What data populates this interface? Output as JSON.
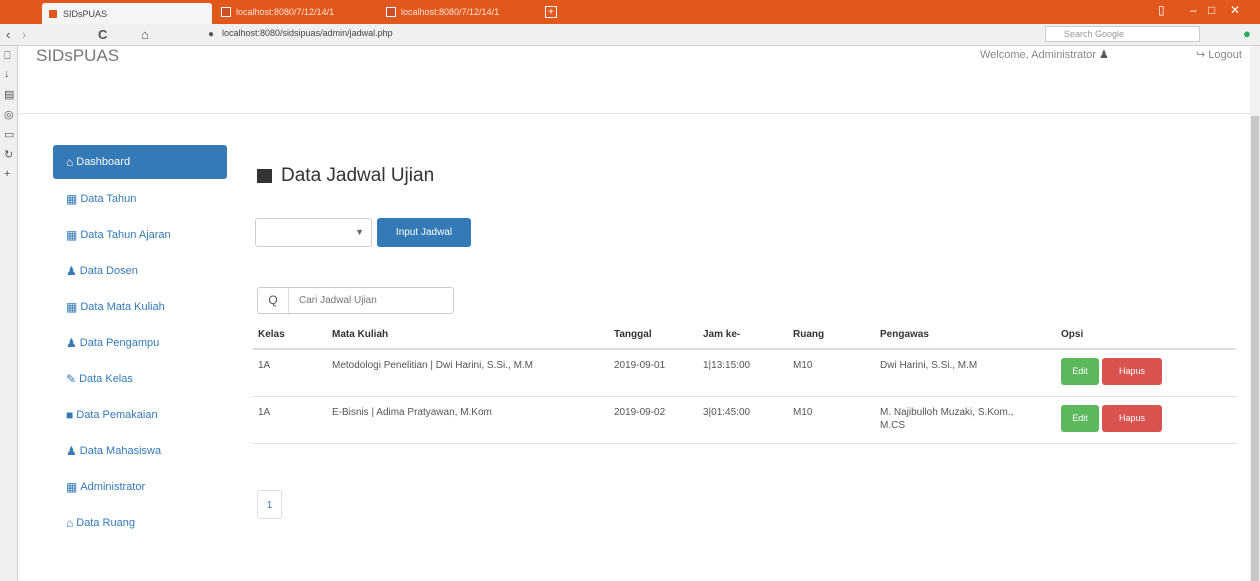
{
  "browser": {
    "tabs": [
      {
        "title": "SIDsPUAS"
      },
      {
        "title": "localhost:8080/7/12/14/1"
      },
      {
        "title": "localhost:8080/7/12/14/1"
      }
    ],
    "new_tab": "+",
    "url": "localhost:8080/sidsipuas/admin/jadwal.php",
    "search_placeholder": "Search Google"
  },
  "header": {
    "brand": "SIDsPUAS",
    "welcome": "Welcome, Administrator",
    "logout": "Logout"
  },
  "sidebar": {
    "items": [
      {
        "label": "Dashboard",
        "icon": "home-icon",
        "glyph": "⌂"
      },
      {
        "label": "Data Tahun",
        "icon": "table-icon",
        "glyph": "▦"
      },
      {
        "label": "Data Tahun Ajaran",
        "icon": "table-icon",
        "glyph": "▦"
      },
      {
        "label": "Data Dosen",
        "icon": "user-icon",
        "glyph": "♟"
      },
      {
        "label": "Data Mata Kuliah",
        "icon": "table-icon",
        "glyph": "▦"
      },
      {
        "label": "Data Pengampu",
        "icon": "user-icon",
        "glyph": "♟"
      },
      {
        "label": "Data Kelas",
        "icon": "pencil-icon",
        "glyph": "✎"
      },
      {
        "label": "Data Pemakaian",
        "icon": "book-icon",
        "glyph": "■"
      },
      {
        "label": "Data Mahasiswa",
        "icon": "user-icon",
        "glyph": "♟"
      },
      {
        "label": "Administrator",
        "icon": "table-icon",
        "glyph": "▦"
      },
      {
        "label": "Data Ruang",
        "icon": "home-icon",
        "glyph": "⌂"
      }
    ]
  },
  "main": {
    "title": "Data Jadwal Ujian",
    "select_value": "",
    "input_button": "Input Jadwal",
    "search_icon": "Q",
    "search_placeholder": "Cari Jadwal Ujian",
    "columns": [
      "Kelas",
      "Mata Kuliah",
      "Tanggal",
      "Jam ke-",
      "Ruang",
      "Pengawas",
      "Opsi"
    ],
    "rows": [
      {
        "kelas": "1A",
        "mata_kuliah": "Metodologi Penelitian | Dwi Harini, S.Si., M.M",
        "tanggal": "2019-09-01",
        "jam": "1|13:15:00",
        "ruang": "M10",
        "pengawas": "Dwi Harini, S.Si., M.M"
      },
      {
        "kelas": "1A",
        "mata_kuliah": "E-Bisnis | Adima Pratyawan, M.Kom",
        "tanggal": "2019-09-02",
        "jam": "3|01:45:00",
        "ruang": "M10",
        "pengawas": "M. Najibulloh Muzaki, S.Kom., M.CS"
      }
    ],
    "edit_label": "Edit",
    "delete_label": "Hapus",
    "page_number": "1"
  }
}
